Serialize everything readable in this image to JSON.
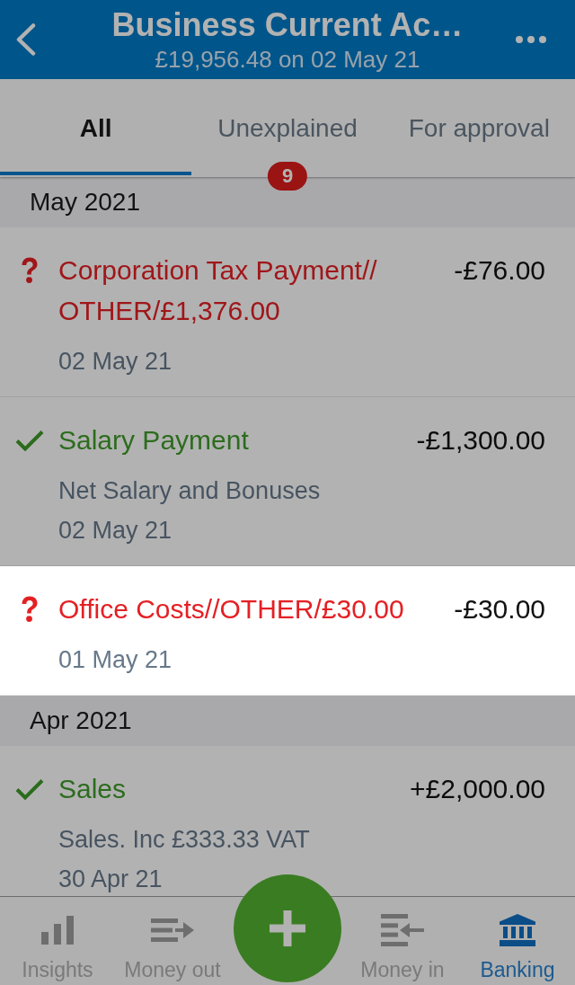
{
  "header": {
    "title": "Business Current Ac…",
    "subtitle": "£19,956.48 on 02 May 21"
  },
  "tabs": [
    {
      "label": "All",
      "selected": true
    },
    {
      "label": "Unexplained",
      "selected": false,
      "badge": "9"
    },
    {
      "label": "For approval",
      "selected": false
    }
  ],
  "sections": [
    {
      "heading": "May 2021",
      "transactions": [
        {
          "title": "Corporation Tax Payment//OTHER/£1,376.00",
          "date": "02 May 21",
          "amount": "-£76.00",
          "explained": false,
          "highlighted": false
        },
        {
          "title": "Salary Payment",
          "description": "Net Salary and Bonuses",
          "date": "02 May 21",
          "amount": "-£1,300.00",
          "explained": true,
          "highlighted": false
        },
        {
          "title": "Office Costs//OTHER/£30.00",
          "date": "01 May 21",
          "amount": "-£30.00",
          "explained": false,
          "highlighted": true
        }
      ]
    },
    {
      "heading": "Apr 2021",
      "transactions": [
        {
          "title": "Sales",
          "description": "Sales. Inc £333.33 VAT",
          "date": "30 Apr 21",
          "amount": "+£2,000.00",
          "explained": true,
          "highlighted": false
        }
      ]
    }
  ],
  "bottom_nav": [
    {
      "label": "Insights",
      "selected": false
    },
    {
      "label": "Money out",
      "selected": false
    },
    {
      "label": "Money in",
      "selected": false
    },
    {
      "label": "Banking",
      "selected": true
    }
  ]
}
